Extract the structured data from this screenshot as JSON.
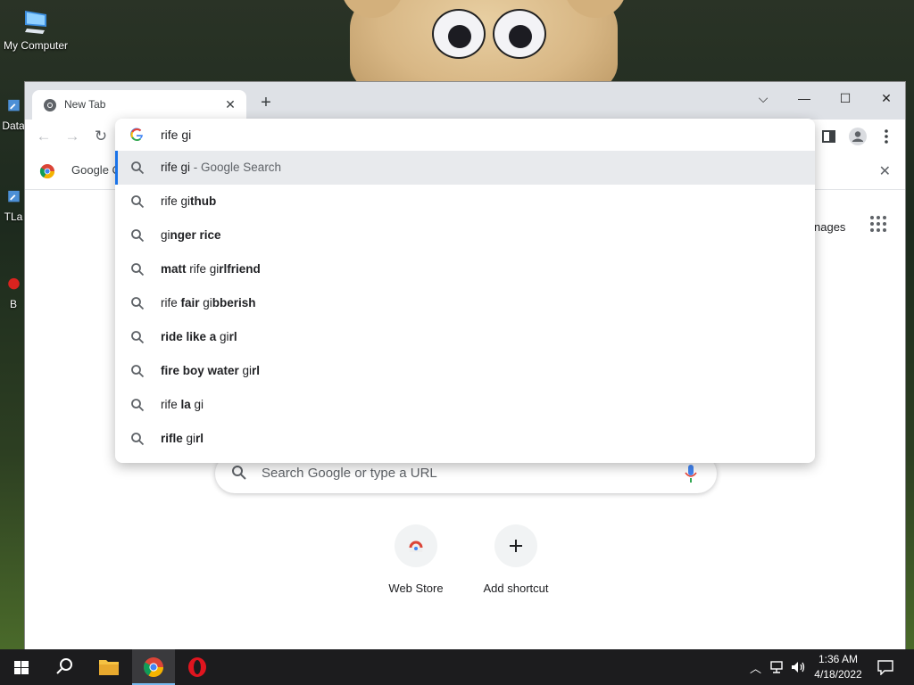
{
  "desktop": {
    "icons": [
      {
        "label": "My Computer"
      },
      {
        "label": "Data"
      },
      {
        "label": "TLa"
      },
      {
        "label": "B"
      }
    ]
  },
  "browser": {
    "tab_title": "New Tab",
    "tab_close": "✕",
    "new_tab": "+",
    "window_controls": {
      "menu": "⌵",
      "minimize": "—",
      "maximize": "☐",
      "close": "✕"
    },
    "nav": {
      "back": "←",
      "forward": "→",
      "reload": "↻"
    },
    "bookmark": {
      "label": "Google C",
      "close": "✕"
    },
    "omnibox": {
      "text": "rife gi",
      "suggestions": [
        {
          "parts": [
            {
              "t": "rife gi",
              "b": false
            },
            {
              "t": " - Google Search",
              "b": false,
              "hint": true
            }
          ]
        },
        {
          "parts": [
            {
              "t": "rife gi",
              "b": false
            },
            {
              "t": "thub",
              "b": true
            }
          ]
        },
        {
          "parts": [
            {
              "t": "gi",
              "b": false
            },
            {
              "t": "nger rice",
              "b": true
            }
          ]
        },
        {
          "parts": [
            {
              "t": "matt",
              "b": true
            },
            {
              "t": " rife gi",
              "b": false
            },
            {
              "t": "rlfriend",
              "b": true
            }
          ]
        },
        {
          "parts": [
            {
              "t": "rife ",
              "b": false
            },
            {
              "t": "fair",
              "b": true
            },
            {
              "t": " gi",
              "b": false
            },
            {
              "t": "bberish",
              "b": true
            }
          ]
        },
        {
          "parts": [
            {
              "t": "ride like a",
              "b": true
            },
            {
              "t": " gi",
              "b": false
            },
            {
              "t": "rl",
              "b": true
            }
          ]
        },
        {
          "parts": [
            {
              "t": "fire boy water",
              "b": true
            },
            {
              "t": " gi",
              "b": false
            },
            {
              "t": "rl",
              "b": true
            }
          ]
        },
        {
          "parts": [
            {
              "t": "rife ",
              "b": false
            },
            {
              "t": "la",
              "b": true
            },
            {
              "t": " gi",
              "b": false
            }
          ]
        },
        {
          "parts": [
            {
              "t": "rifle",
              "b": true
            },
            {
              "t": " gi",
              "b": false
            },
            {
              "t": "rl",
              "b": true
            }
          ]
        }
      ]
    },
    "ntp": {
      "images_link": "nages",
      "search_placeholder": "Search Google or type a URL",
      "shortcuts": [
        {
          "label": "Web Store"
        },
        {
          "label": "Add shortcut"
        }
      ]
    }
  },
  "taskbar": {
    "time": "1:36 AM",
    "date": "4/18/2022"
  }
}
